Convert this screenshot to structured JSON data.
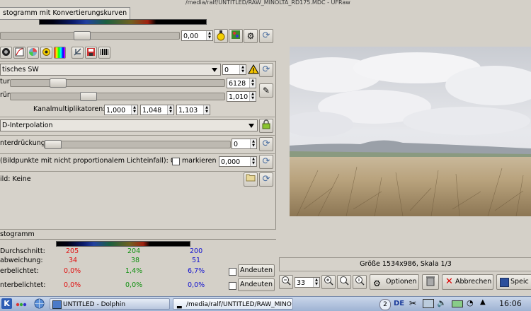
{
  "window": {
    "title": "/media/ralf/UNTITLED/RAW_MINOLTA_RD175.MDC - UFRaw"
  },
  "histogram_top": {
    "label": "stogramm mit Konvertierungskurven"
  },
  "exposure": {
    "value": "0,00"
  },
  "white_balance": {
    "preset": "tisches SW",
    "fine": "0",
    "temperature_label": "tur",
    "temperature": "6128",
    "green_label": "rün",
    "green": "1,010"
  },
  "channel_multipliers": {
    "label": "Kanalmultiplikatoren:",
    "r": "1,000",
    "g": "1,048",
    "b": "1,103"
  },
  "interpolation": {
    "value": "D-Interpolation"
  },
  "denoise": {
    "label": "nterdrückung",
    "value": "0"
  },
  "hotpixel": {
    "label": "(Bildpunkte mit nicht proportionalem Lichteinfall): 0",
    "mark_label": "markieren",
    "value": "0,000"
  },
  "darkframe": {
    "label": "ild: Keine"
  },
  "stats": {
    "title": "stogramm",
    "rows": [
      {
        "label": "Durchschnitt:",
        "r": "205",
        "g": "204",
        "b": "200",
        "button": ""
      },
      {
        "label": "abweichung:",
        "r": "34",
        "g": "38",
        "b": "51",
        "button": ""
      },
      {
        "label": "erbelichtet:",
        "r": "0,0%",
        "g": "1,4%",
        "b": "6,7%",
        "button": "Andeuten"
      },
      {
        "label": "nterbelichtet:",
        "r": "0,0%",
        "g": "0,0%",
        "b": "0,0%",
        "button": "Andeuten"
      }
    ],
    "colors": {
      "r": "#e01010",
      "g": "#109010",
      "b": "#1010d0"
    }
  },
  "preview": {
    "size_label": "Größe 1534x986, Skala 1/3"
  },
  "bottom_bar": {
    "zoom": "33",
    "options": "Optionen",
    "cancel": "Abbrechen",
    "save": "Speic"
  },
  "taskbar": {
    "task1": "UNTITLED - Dolphin",
    "task2": "/media/ralf/UNTITLED/RAW_MINO",
    "badge": "2",
    "lang": "DE",
    "clock": "16:06"
  }
}
